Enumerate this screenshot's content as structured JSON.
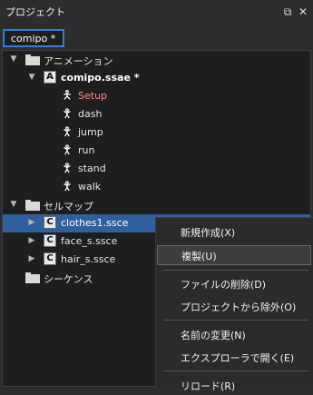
{
  "panel": {
    "title": "プロジェクト",
    "active_tab": "comipo *"
  },
  "titlebar_icons": {
    "dock": "dock-icon",
    "close": "close-icon"
  },
  "tree": {
    "animation_folder": "アニメーション",
    "ssae_file": "comipo.ssae *",
    "ssae_icon_letter": "A",
    "animations": [
      "Setup",
      "dash",
      "jump",
      "run",
      "stand",
      "walk"
    ],
    "cellmap_folder": "セルマップ",
    "cellmaps": [
      "clothes1.ssce",
      "face_s.ssce",
      "hair_s.ssce"
    ],
    "cellmap_icon_letter": "C",
    "sequence_folder": "シーケンス"
  },
  "context_menu": {
    "new": "新規作成(X)",
    "duplicate": "複製(U)",
    "delete_file": "ファイルの削除(D)",
    "exclude": "プロジェクトから除外(O)",
    "rename": "名前の変更(N)",
    "open_explorer": "エクスプローラで開く(E)",
    "reload": "リロード(R)"
  },
  "colors": {
    "accent_tab": "#3b7ad9",
    "selection": "#2f5f9d",
    "setup_text": "#ff8b8b"
  }
}
